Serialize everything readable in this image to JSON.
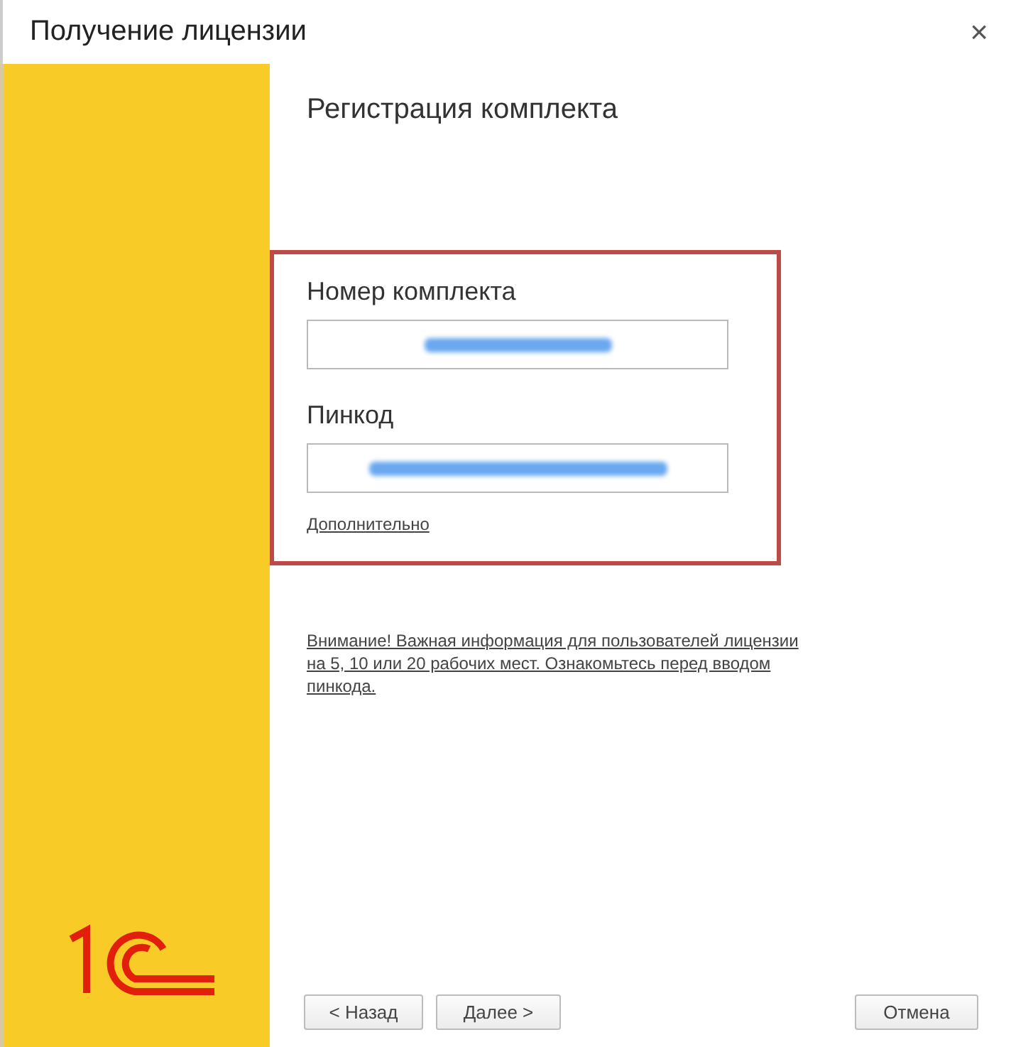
{
  "window": {
    "title": "Получение лицензии",
    "close": "×"
  },
  "heading": "Регистрация комплекта",
  "fields": [
    {
      "label": "Номер комплекта",
      "kind": "serial"
    },
    {
      "label": "Пинкод",
      "kind": "pin"
    }
  ],
  "more_link": "Дополнительно",
  "notice": "Внимание! Важная информация для пользователей лицензии на 5, 10 или 20 рабочих мест. Ознакомьтесь перед вводом пинкода.",
  "buttons": [
    {
      "label": "< Назад",
      "kind": "back"
    },
    {
      "label": "Далее >",
      "kind": "next"
    },
    {
      "label": "Отмена",
      "kind": "cancel"
    }
  ]
}
